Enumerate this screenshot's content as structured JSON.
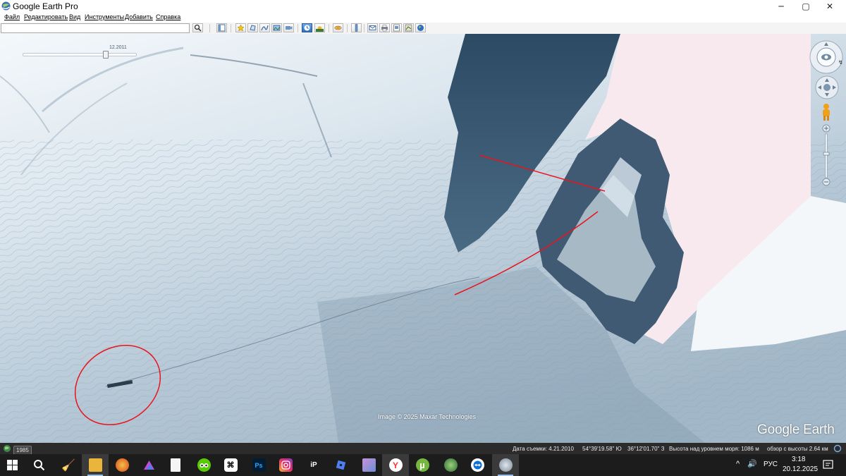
{
  "window": {
    "title": "Google Earth Pro",
    "controls": {
      "minimize": "─",
      "maximize": "▢",
      "close": "✕"
    }
  },
  "menu": {
    "items": [
      "Файл",
      "Редактировать",
      "Вид",
      "Инструменты",
      "Добавить",
      "Справка"
    ]
  },
  "toolbar": {
    "search_value": "",
    "buttons": [
      "search-icon",
      "sidebar-toggle-icon",
      "placemark-icon",
      "polygon-icon",
      "path-icon",
      "image-overlay-icon",
      "record-tour-icon",
      "historical-imagery-icon",
      "sunlight-icon",
      "planets-icon",
      "ruler-icon",
      "email-icon",
      "print-icon",
      "save-image-icon",
      "view-in-maps-icon",
      "earth-icon"
    ]
  },
  "map": {
    "time_slider_date": "12.2011",
    "imagery_credit": "Image © 2025 Maxar Technologies",
    "logo": "Google Earth",
    "annotation_color": "#e8141e"
  },
  "status": {
    "year": "1985",
    "capture_date": "Дата съемки: 4.21.2010",
    "latitude": "54°39'19.58\" Ю",
    "longitude": "36°12'01.70\" З",
    "elevation": "Высота над уровнем моря:  1086 м",
    "eye_alt": "обзор с высоты   2.64 км"
  },
  "taskbar": {
    "apps": [
      "file-explorer-icon",
      "unknown-browser-icon",
      "affinity-icon",
      "notepad-icon",
      "duolingo-icon",
      "capcut-icon",
      "photoshop-icon",
      "instagram-icon",
      "ibis-paint-icon",
      "roblox-icon",
      "image-viewer-icon",
      "yandex-browser-icon",
      "utorrent-icon",
      "map-app-icon",
      "teamviewer-icon",
      "google-earth-icon"
    ],
    "app_labels": {
      "photoshop": "Ps",
      "yandex": "Y",
      "utorrent": "µ",
      "ibis": "iP",
      "capcut": "⌘"
    },
    "language": "РУС",
    "time": "3:18",
    "date": "20.12.2025",
    "tray_chevron": "^",
    "volume": "🔊"
  }
}
